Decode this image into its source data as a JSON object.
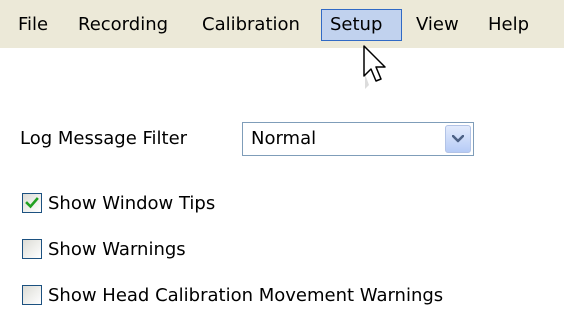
{
  "menubar": {
    "items": [
      {
        "label": "File"
      },
      {
        "label": "Recording"
      },
      {
        "label": "Calibration"
      },
      {
        "label": "Setup"
      },
      {
        "label": "View"
      },
      {
        "label": "Help"
      }
    ],
    "active_item": "Setup"
  },
  "panel": {
    "log_filter": {
      "label": "Log Message Filter",
      "value": "Normal"
    },
    "checkboxes": [
      {
        "label": "Show Window Tips",
        "checked": true
      },
      {
        "label": "Show Warnings",
        "checked": false
      },
      {
        "label": "Show Head Calibration Movement Warnings",
        "checked": false
      }
    ]
  },
  "colors": {
    "menubar_bg": "#ece9d8",
    "menu_highlight": "#c1d2ee",
    "menu_highlight_border": "#316ac5",
    "check_mark": "#21a121"
  },
  "icons": [
    "mouse-pointer-icon",
    "dropdown-arrow-icon",
    "checkmark-icon"
  ]
}
